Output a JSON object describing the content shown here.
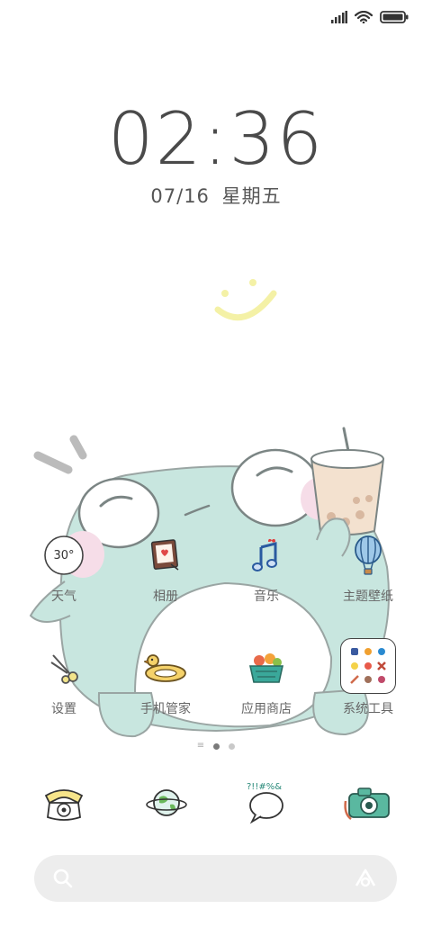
{
  "status_bar": {
    "signal_icon": "signal-bars-icon",
    "wifi_icon": "wifi-icon",
    "battery_icon": "battery-icon"
  },
  "lock": {
    "time": "02:36",
    "date": "07/16",
    "weekday": "星期五"
  },
  "apps": [
    {
      "label": "天气",
      "icon": "weather-icon",
      "badge": "30°"
    },
    {
      "label": "相册",
      "icon": "gallery-icon"
    },
    {
      "label": "音乐",
      "icon": "music-icon"
    },
    {
      "label": "主题壁纸",
      "icon": "themes-balloon-icon"
    },
    {
      "label": "设置",
      "icon": "settings-scissors-icon"
    },
    {
      "label": "手机管家",
      "icon": "security-duck-icon"
    },
    {
      "label": "应用商店",
      "icon": "app-store-basket-icon"
    },
    {
      "label": "系统工具",
      "icon": "system-tools-folder-icon"
    }
  ],
  "pager": {
    "pages": 2,
    "current": 1
  },
  "dock": [
    {
      "icon": "phone-icon"
    },
    {
      "icon": "browser-globe-icon"
    },
    {
      "icon": "messages-icon",
      "doodle": "?!!#%&"
    },
    {
      "icon": "camera-icon"
    }
  ],
  "colors": {
    "frog": "#c8e6df",
    "smile": "#f4f1a6",
    "text": "#666666",
    "search_bg": "#ededed"
  }
}
